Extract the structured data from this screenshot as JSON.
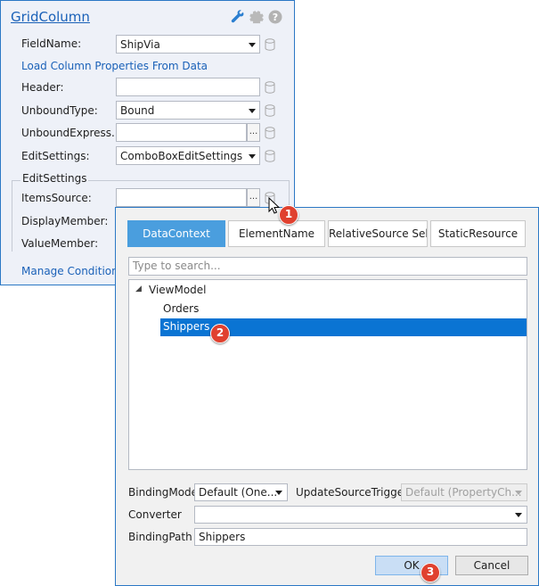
{
  "panel": {
    "title": "GridColumn",
    "icons": [
      "wrench-icon",
      "gear-icon",
      "help-icon"
    ],
    "field_name": {
      "label": "FieldName:",
      "value": "ShipVia"
    },
    "load_link": "Load Column Properties From Data",
    "header": {
      "label": "Header:",
      "value": ""
    },
    "unbound_type": {
      "label": "UnboundType:",
      "value": "Bound"
    },
    "unbound_expression": {
      "label": "UnboundExpress...",
      "value": "",
      "button": "..."
    },
    "edit_settings": {
      "label": "EditSettings:",
      "value": "ComboBoxEditSettings"
    },
    "edit_settings_group": {
      "title": "EditSettings",
      "items_source": {
        "label": "ItemsSource:",
        "value": "",
        "button": "..."
      },
      "display_member": {
        "label": "DisplayMember:"
      },
      "value_member": {
        "label": "ValueMember:"
      }
    },
    "manage_link": "Manage Conditional"
  },
  "dialog": {
    "tabs": [
      {
        "label": "DataContext",
        "active": true
      },
      {
        "label": "ElementName",
        "active": false
      },
      {
        "label": "RelativeSource Self",
        "active": false
      },
      {
        "label": "StaticResource",
        "active": false
      }
    ],
    "search_placeholder": "Type to search...",
    "tree": {
      "root": "ViewModel",
      "children": [
        "Orders",
        "Shippers"
      ],
      "selected": "Shippers"
    },
    "binding_mode": {
      "label": "BindingMode",
      "value": "Default (One..."
    },
    "update_trigger": {
      "label": "UpdateSourceTrigger",
      "value": "Default (PropertyCh..."
    },
    "converter": {
      "label": "Converter",
      "value": ""
    },
    "binding_path": {
      "label": "BindingPath",
      "value": "Shippers"
    },
    "ok_label": "OK",
    "cancel_label": "Cancel"
  },
  "badges": [
    "1",
    "2",
    "3"
  ],
  "colors": {
    "accent": "#2b78c5",
    "link": "#1a61b8",
    "tab_active": "#4a9ede",
    "selection": "#0a74d3",
    "badge": "#e0412f"
  }
}
